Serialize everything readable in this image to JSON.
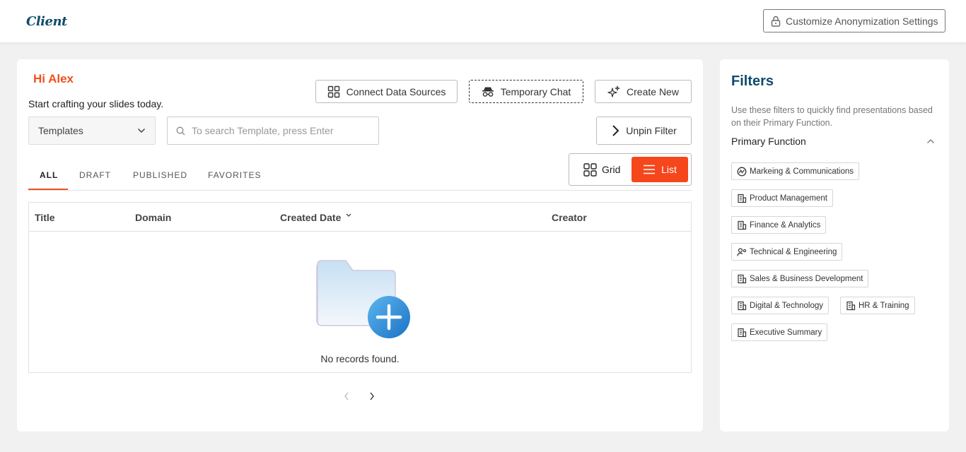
{
  "header": {
    "logo": "Client",
    "anonymization_button": "Customize Anonymization Settings"
  },
  "main": {
    "greeting": "Hi Alex",
    "subtitle": "Start crafting your slides today.",
    "buttons": {
      "connect": "Connect Data Sources",
      "temporary_chat": "Temporary Chat",
      "create_new": "Create New",
      "unpin_filter": "Unpin Filter"
    },
    "type_select": {
      "value": "Templates"
    },
    "search": {
      "placeholder": "To search Template, press Enter"
    },
    "view_toggle": {
      "grid": "Grid",
      "list": "List",
      "active": "list"
    },
    "tabs": [
      {
        "label": "ALL",
        "active": true
      },
      {
        "label": "DRAFT"
      },
      {
        "label": "PUBLISHED"
      },
      {
        "label": "FAVORITES"
      }
    ],
    "table": {
      "columns": [
        "Title",
        "Domain",
        "Created Date",
        "Creator"
      ],
      "rows": [],
      "empty_message": "No records found."
    }
  },
  "filters": {
    "title": "Filters",
    "description": "Use these filters to quickly find presentations based on their Primary Function.",
    "section": "Primary Function",
    "chips": [
      {
        "label": "Markeing & Communications",
        "icon": "chart-circle-icon"
      },
      {
        "label": "Product Management",
        "icon": "building-icon"
      },
      {
        "label": "Finance & Analytics",
        "icon": "building-icon"
      },
      {
        "label": "Technical & Engineering",
        "icon": "user-gear-icon"
      },
      {
        "label": "Sales & Business Development",
        "icon": "building-icon"
      },
      {
        "label": "Digital & Technology",
        "icon": "building-icon"
      },
      {
        "label": "HR & Training",
        "icon": "building-icon"
      },
      {
        "label": "Executive Summary",
        "icon": "building-icon"
      }
    ]
  },
  "colors": {
    "accent": "#f5461c",
    "brand": "#0f4c6b",
    "background": "#f1f1f1"
  }
}
